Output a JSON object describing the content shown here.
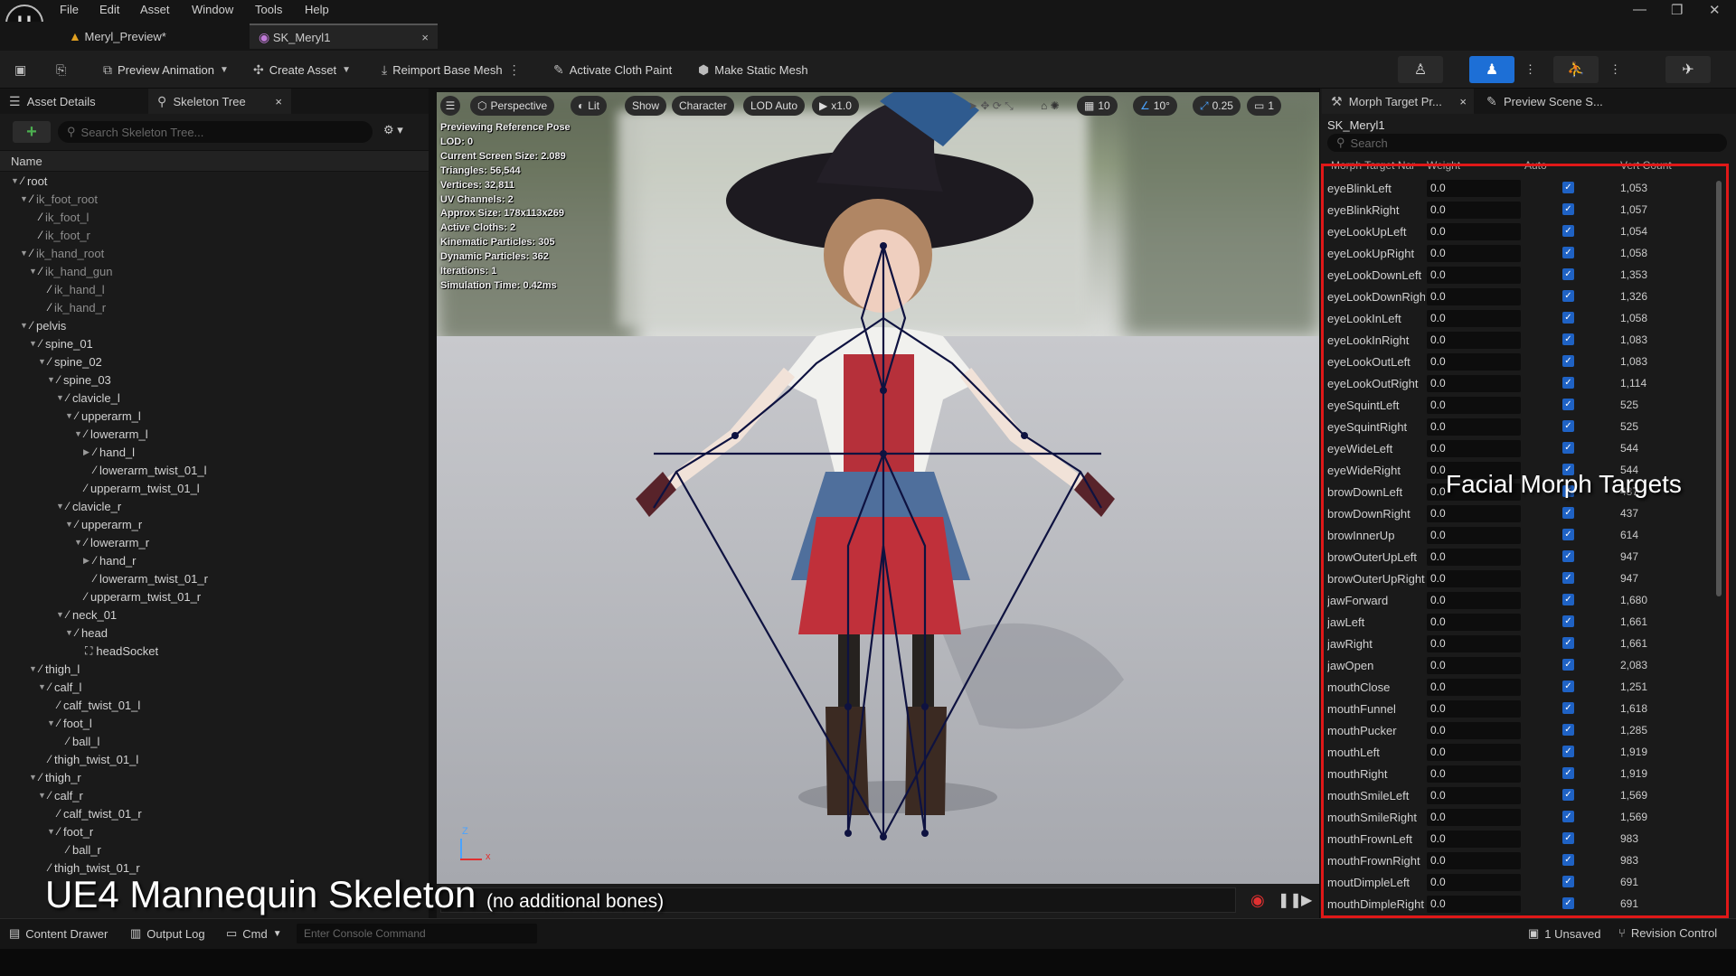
{
  "menu": [
    "File",
    "Edit",
    "Asset",
    "Window",
    "Tools",
    "Help"
  ],
  "window_controls": {
    "minimize": "—",
    "restore": "❐",
    "close": "✕"
  },
  "doc_tabs": [
    {
      "label": "Meryl_Preview*",
      "active": false
    },
    {
      "label": "SK_Meryl1",
      "active": true,
      "close": "×"
    }
  ],
  "toolbar": {
    "preview_animation": "Preview Animation",
    "create_asset": "Create Asset",
    "reimport": "Reimport Base Mesh",
    "cloth_paint": "Activate Cloth Paint",
    "static_mesh": "Make Static Mesh"
  },
  "left_tabs": [
    "Asset Details",
    "Skeleton Tree"
  ],
  "skeleton_search_placeholder": "Search Skeleton Tree...",
  "tree_column": "Name",
  "bones": [
    {
      "n": "root",
      "d": 0,
      "a": "▼",
      "v": false
    },
    {
      "n": "ik_foot_root",
      "d": 1,
      "a": "▼",
      "v": true
    },
    {
      "n": "ik_foot_l",
      "d": 2,
      "a": "",
      "v": true
    },
    {
      "n": "ik_foot_r",
      "d": 2,
      "a": "",
      "v": true
    },
    {
      "n": "ik_hand_root",
      "d": 1,
      "a": "▼",
      "v": true
    },
    {
      "n": "ik_hand_gun",
      "d": 2,
      "a": "▼",
      "v": true
    },
    {
      "n": "ik_hand_l",
      "d": 3,
      "a": "",
      "v": true
    },
    {
      "n": "ik_hand_r",
      "d": 3,
      "a": "",
      "v": true
    },
    {
      "n": "pelvis",
      "d": 1,
      "a": "▼",
      "v": false
    },
    {
      "n": "spine_01",
      "d": 2,
      "a": "▼",
      "v": false
    },
    {
      "n": "spine_02",
      "d": 3,
      "a": "▼",
      "v": false
    },
    {
      "n": "spine_03",
      "d": 4,
      "a": "▼",
      "v": false
    },
    {
      "n": "clavicle_l",
      "d": 5,
      "a": "▼",
      "v": false
    },
    {
      "n": "upperarm_l",
      "d": 6,
      "a": "▼",
      "v": false
    },
    {
      "n": "lowerarm_l",
      "d": 7,
      "a": "▼",
      "v": false
    },
    {
      "n": "hand_l",
      "d": 8,
      "a": "▶",
      "v": false
    },
    {
      "n": "lowerarm_twist_01_l",
      "d": 8,
      "a": "",
      "v": false
    },
    {
      "n": "upperarm_twist_01_l",
      "d": 7,
      "a": "",
      "v": false
    },
    {
      "n": "clavicle_r",
      "d": 5,
      "a": "▼",
      "v": false
    },
    {
      "n": "upperarm_r",
      "d": 6,
      "a": "▼",
      "v": false
    },
    {
      "n": "lowerarm_r",
      "d": 7,
      "a": "▼",
      "v": false
    },
    {
      "n": "hand_r",
      "d": 8,
      "a": "▶",
      "v": false
    },
    {
      "n": "lowerarm_twist_01_r",
      "d": 8,
      "a": "",
      "v": false
    },
    {
      "n": "upperarm_twist_01_r",
      "d": 7,
      "a": "",
      "v": false
    },
    {
      "n": "neck_01",
      "d": 5,
      "a": "▼",
      "v": false
    },
    {
      "n": "head",
      "d": 6,
      "a": "▼",
      "v": false
    },
    {
      "n": "headSocket",
      "d": 7,
      "a": "",
      "v": false,
      "socket": true
    },
    {
      "n": "thigh_l",
      "d": 2,
      "a": "▼",
      "v": false
    },
    {
      "n": "calf_l",
      "d": 3,
      "a": "▼",
      "v": false
    },
    {
      "n": "calf_twist_01_l",
      "d": 4,
      "a": "",
      "v": false
    },
    {
      "n": "foot_l",
      "d": 4,
      "a": "▼",
      "v": false
    },
    {
      "n": "ball_l",
      "d": 5,
      "a": "",
      "v": false
    },
    {
      "n": "thigh_twist_01_l",
      "d": 3,
      "a": "",
      "v": false
    },
    {
      "n": "thigh_r",
      "d": 2,
      "a": "▼",
      "v": false
    },
    {
      "n": "calf_r",
      "d": 3,
      "a": "▼",
      "v": false
    },
    {
      "n": "calf_twist_01_r",
      "d": 4,
      "a": "",
      "v": false
    },
    {
      "n": "foot_r",
      "d": 4,
      "a": "▼",
      "v": false
    },
    {
      "n": "ball_r",
      "d": 5,
      "a": "",
      "v": false
    },
    {
      "n": "thigh_twist_01_r",
      "d": 3,
      "a": "",
      "v": false
    }
  ],
  "viewport": {
    "buttons": [
      "Perspective",
      "Lit",
      "Show",
      "Character",
      "LOD Auto",
      "x1.0"
    ],
    "grid": "10",
    "angle": "10°",
    "scale": "0.25",
    "cam": "1",
    "stats": [
      "Previewing Reference Pose",
      "LOD: 0",
      "Current Screen Size: 2.089",
      "Triangles: 56,544",
      "Vertices: 32,811",
      "UV Channels: 2",
      "Approx Size: 178x113x269",
      "Active Cloths: 2",
      "Kinematic Particles: 305",
      "Dynamic Particles: 362",
      "Iterations: 1",
      "Simulation Time: 0.42ms"
    ],
    "axis_z": "Z",
    "axis_x": "x"
  },
  "overlay": {
    "title": "UE4 Mannequin Skeleton",
    "subtitle": "(no additional bones)",
    "facial": "Facial Morph Targets"
  },
  "right_tabs": [
    "Morph Target Pr...",
    "Preview Scene S..."
  ],
  "asset_name": "SK_Meryl1",
  "morph_search": "Search",
  "morph_headers": [
    "Morph Target Nar",
    "Weight",
    "Auto",
    "Vert Count"
  ],
  "morphs": [
    [
      "eyeBlinkLeft",
      "0.0",
      "1,053"
    ],
    [
      "eyeBlinkRight",
      "0.0",
      "1,057"
    ],
    [
      "eyeLookUpLeft",
      "0.0",
      "1,054"
    ],
    [
      "eyeLookUpRight",
      "0.0",
      "1,058"
    ],
    [
      "eyeLookDownLeft",
      "0.0",
      "1,353"
    ],
    [
      "eyeLookDownRigh",
      "0.0",
      "1,326"
    ],
    [
      "eyeLookInLeft",
      "0.0",
      "1,058"
    ],
    [
      "eyeLookInRight",
      "0.0",
      "1,083"
    ],
    [
      "eyeLookOutLeft",
      "0.0",
      "1,083"
    ],
    [
      "eyeLookOutRight",
      "0.0",
      "1,114"
    ],
    [
      "eyeSquintLeft",
      "0.0",
      "525"
    ],
    [
      "eyeSquintRight",
      "0.0",
      "525"
    ],
    [
      "eyeWideLeft",
      "0.0",
      "544"
    ],
    [
      "eyeWideRight",
      "0.0",
      "544"
    ],
    [
      "browDownLeft",
      "0.0",
      "437"
    ],
    [
      "browDownRight",
      "0.0",
      "437"
    ],
    [
      "browInnerUp",
      "0.0",
      "614"
    ],
    [
      "browOuterUpLeft",
      "0.0",
      "947"
    ],
    [
      "browOuterUpRight",
      "0.0",
      "947"
    ],
    [
      "jawForward",
      "0.0",
      "1,680"
    ],
    [
      "jawLeft",
      "0.0",
      "1,661"
    ],
    [
      "jawRight",
      "0.0",
      "1,661"
    ],
    [
      "jawOpen",
      "0.0",
      "2,083"
    ],
    [
      "mouthClose",
      "0.0",
      "1,251"
    ],
    [
      "mouthFunnel",
      "0.0",
      "1,618"
    ],
    [
      "mouthPucker",
      "0.0",
      "1,285"
    ],
    [
      "mouthLeft",
      "0.0",
      "1,919"
    ],
    [
      "mouthRight",
      "0.0",
      "1,919"
    ],
    [
      "mouthSmileLeft",
      "0.0",
      "1,569"
    ],
    [
      "mouthSmileRight",
      "0.0",
      "1,569"
    ],
    [
      "mouthFrownLeft",
      "0.0",
      "983"
    ],
    [
      "mouthFrownRight",
      "0.0",
      "983"
    ],
    [
      "moutDimpleLeft",
      "0.0",
      "691"
    ],
    [
      "mouthDimpleRight",
      "0.0",
      "691"
    ]
  ],
  "status": {
    "content_drawer": "Content Drawer",
    "output_log": "Output Log",
    "cmd": "Cmd",
    "console_placeholder": "Enter Console Command",
    "unsaved": "1 Unsaved",
    "revision": "Revision Control"
  }
}
